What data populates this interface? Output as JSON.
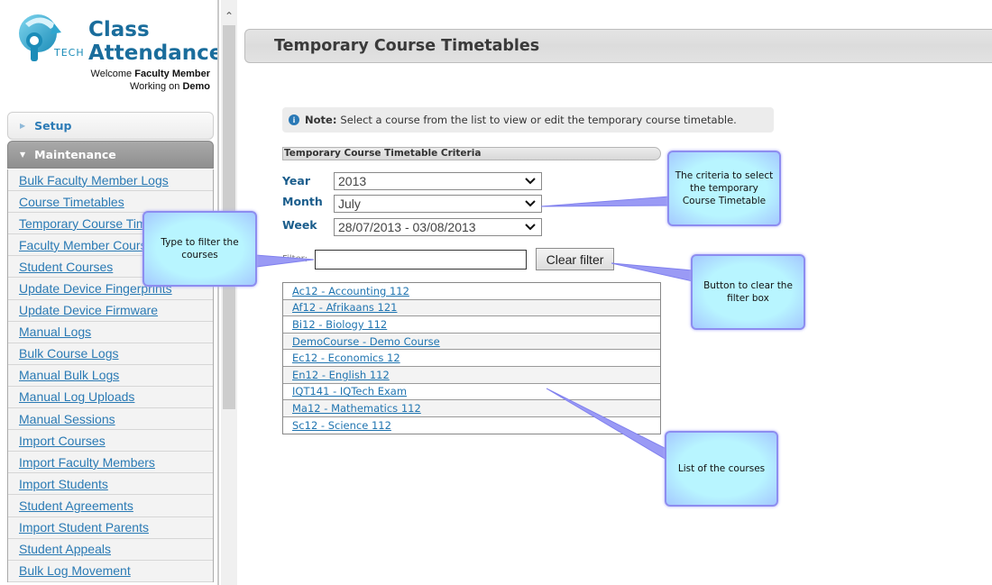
{
  "app": {
    "title_line1": "Class",
    "title_line2": "Attendance",
    "logo_text": "TECH",
    "welcome_prefix": "Welcome",
    "welcome_user": "Faculty Member",
    "working_prefix": "Working on",
    "working_on": "Demo"
  },
  "sidebar": {
    "sections": [
      {
        "label": "Setup",
        "expanded": false
      },
      {
        "label": "Maintenance",
        "expanded": true
      }
    ],
    "items": [
      {
        "label": "Bulk Faculty Member Logs"
      },
      {
        "label": "Course Timetables"
      },
      {
        "label": "Temporary Course Timetables"
      },
      {
        "label": "Faculty Member Courses"
      },
      {
        "label": "Student Courses"
      },
      {
        "label": "Update Device Fingerprints"
      },
      {
        "label": "Update Device Firmware"
      },
      {
        "label": "Manual Logs"
      },
      {
        "label": "Bulk Course Logs"
      },
      {
        "label": "Manual Bulk Logs"
      },
      {
        "label": "Manual Log Uploads"
      },
      {
        "label": "Manual Sessions"
      },
      {
        "label": "Import Courses"
      },
      {
        "label": "Import Faculty Members"
      },
      {
        "label": "Import Students"
      },
      {
        "label": "Student Agreements"
      },
      {
        "label": "Import Student Parents"
      },
      {
        "label": "Student Appeals"
      },
      {
        "label": "Bulk Log Movement"
      }
    ]
  },
  "main": {
    "page_title": "Temporary Course Timetables",
    "note": {
      "icon": "info-icon",
      "label": "Note:",
      "text": "Select a course from the list to view or edit the temporary course timetable."
    },
    "criteria": {
      "section_title": "Temporary Course Timetable Criteria",
      "year_label": "Year",
      "year_value": "2013",
      "month_label": "Month",
      "month_value": "July",
      "week_label": "Week",
      "week_value": "28/07/2013 - 03/08/2013"
    },
    "filter": {
      "label": "Filter:",
      "value": "",
      "placeholder": "",
      "clear_label": "Clear filter"
    },
    "courses": [
      {
        "label": "Ac12 - Accounting 112"
      },
      {
        "label": "Af12 - Afrikaans 121"
      },
      {
        "label": "Bi12 - Biology 112"
      },
      {
        "label": "DemoCourse - Demo Course"
      },
      {
        "label": "Ec12 - Economics 12"
      },
      {
        "label": "En12 - English 112"
      },
      {
        "label": "IQT141 - IQTech Exam"
      },
      {
        "label": "Ma12 - Mathematics 112"
      },
      {
        "label": "Sc12 - Science 112"
      }
    ]
  },
  "callouts": {
    "criteria": "The criteria to select the temporary Course Timetable",
    "filter": "Type to filter the courses",
    "clear": "Button to clear the filter box",
    "list": "List of the courses"
  },
  "colors": {
    "accent": "#1a6d9c",
    "link": "#2a7ab4",
    "callout_fill": "#b8f5ff",
    "callout_border": "#8d8df0"
  }
}
